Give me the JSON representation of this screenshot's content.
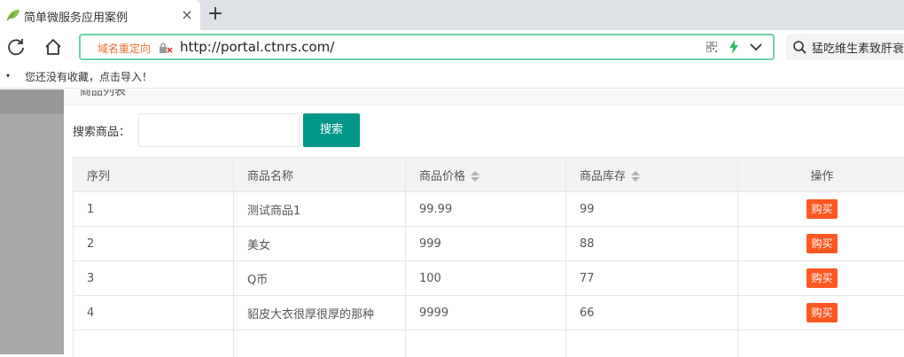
{
  "browser": {
    "tab_title": "简单微服务应用案例",
    "tab_close": "×",
    "new_tab": "+",
    "redirect_badge": "域名重定向",
    "url": "http://portal.ctnrs.com/",
    "search_text": "猛吃维生素致肝衰",
    "bookmark_arrow": "▾",
    "bookmark_hint": "您还没有收藏，点击导入！"
  },
  "modal": {
    "cut_title": "商品列表"
  },
  "search": {
    "label": "搜索商品：",
    "value": "",
    "placeholder": "",
    "button": "搜索"
  },
  "table": {
    "headers": [
      "序列",
      "商品名称",
      "商品价格",
      "商品库存",
      "操作"
    ],
    "rows": [
      {
        "id": "1",
        "name": "测试商品1",
        "price": "99.99",
        "stock": "99",
        "action": "购买"
      },
      {
        "id": "2",
        "name": "美女",
        "price": "999",
        "stock": "88",
        "action": "购买"
      },
      {
        "id": "3",
        "name": "Q币",
        "price": "100",
        "stock": "77",
        "action": "购买"
      },
      {
        "id": "4",
        "name": "貂皮大衣很厚很厚的那种",
        "price": "9999",
        "stock": "66",
        "action": "购买"
      }
    ]
  },
  "colors": {
    "search_button": "#009688",
    "buy_button": "#ff5722",
    "address_border": "#6ad3a4",
    "redirect_text": "#e8712b"
  },
  "icons": [
    "leaf-favicon-icon",
    "reload-icon",
    "home-icon",
    "blocked-lock-icon",
    "qr-code-icon",
    "bolt-icon",
    "chevron-down-icon",
    "search-icon",
    "sort-icon"
  ]
}
